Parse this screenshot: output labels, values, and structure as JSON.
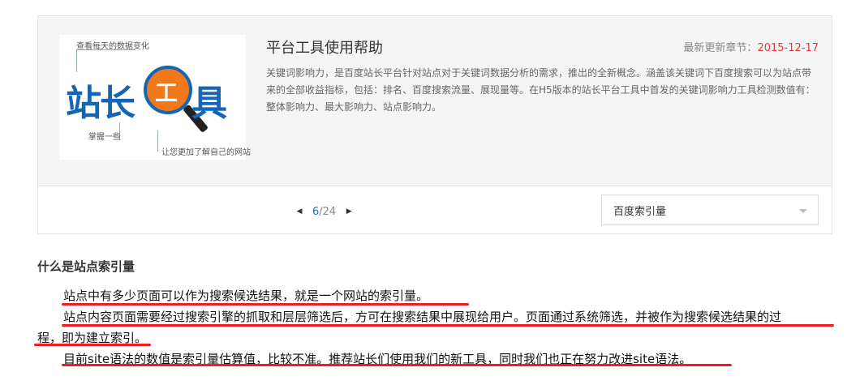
{
  "card": {
    "logo": {
      "top_text": "查看每天的数据变化",
      "main_left": "站长",
      "lens_char": "工",
      "main_right": "具",
      "mid_text": "掌握一些",
      "bottom_text": "让您更加了解自己的网站"
    },
    "title": "平台工具使用帮助",
    "update_label": "最新更新章节：",
    "update_date": "2015-12-17",
    "description": "关键词影响力，是百度站长平台针对站点对于关键词数据分析的需求，推出的全新概念。涵盖该关键词下百度搜索可以为站点带来的全部收益指标，包括：排名、百度搜索流量、展现量等。在H5版本的站长平台工具中首发的关键词影响力工具检测数值有：整体影响力、最大影响力、站点影响力。",
    "pager": {
      "prev_icon": "triangle-left",
      "current": "6",
      "total": "/24",
      "next_icon": "triangle-right"
    },
    "select_value": "百度索引量"
  },
  "article": {
    "heading": "什么是站点索引量",
    "p1": "站点中有多少页面可以作为搜索候选结果，就是一个网站的索引量。",
    "p2_line1": "站点内容页面需要经过搜索引擎的抓取和层层筛选后，方可在搜索结果中展现给用户。页面通过系统筛选，并被作为搜索候选结果的过",
    "p2_line2": "程，即为建立索引。",
    "p3": "目前site语法的数值是索引量估算值，比较不准。推荐站长们使用我们的新工具，同时我们也正在努力改进site语法。"
  },
  "colors": {
    "accent_red": "#e4393c",
    "underline_red": "#ee1d24",
    "page_blue": "#1e6bd6",
    "logo_blue": "#1565b4",
    "logo_orange": "#f07a1b"
  }
}
